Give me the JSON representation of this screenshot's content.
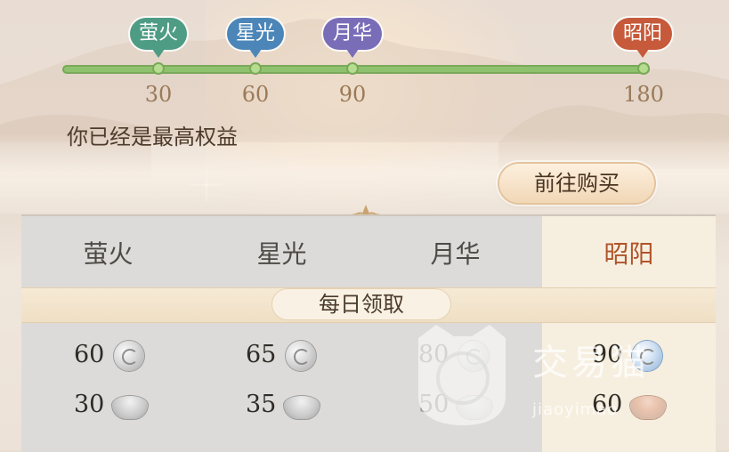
{
  "progress": {
    "tiers": [
      {
        "name": "萤火",
        "value": "30",
        "color": "#4e9c84"
      },
      {
        "name": "星光",
        "value": "60",
        "color": "#4c86b8"
      },
      {
        "name": "月华",
        "value": "90",
        "color": "#7a6db8"
      },
      {
        "name": "昭阳",
        "value": "180",
        "color": "#c65a3a"
      }
    ],
    "fill_fraction": 1.0,
    "status_text": "你已经是最高权益"
  },
  "buy_button": {
    "label": "前往购买"
  },
  "table": {
    "columns": [
      "萤火",
      "星光",
      "月华",
      "昭阳"
    ],
    "highlighted_column": "昭阳",
    "section_label": "每日领取",
    "rows": [
      {
        "icon": [
          "silver-coin-icon",
          "silver-coin-icon",
          "silver-coin-icon",
          "blue-coin-icon"
        ],
        "values": [
          "60",
          "65",
          "80",
          "90"
        ]
      },
      {
        "icon": [
          "bowl-icon",
          "bowl-icon",
          "bowl-icon",
          "red-bowl-icon"
        ],
        "values": [
          "30",
          "35",
          "50",
          "60"
        ]
      }
    ]
  },
  "watermark": {
    "title": "交易猫",
    "subtitle": "jiaoyimao"
  }
}
